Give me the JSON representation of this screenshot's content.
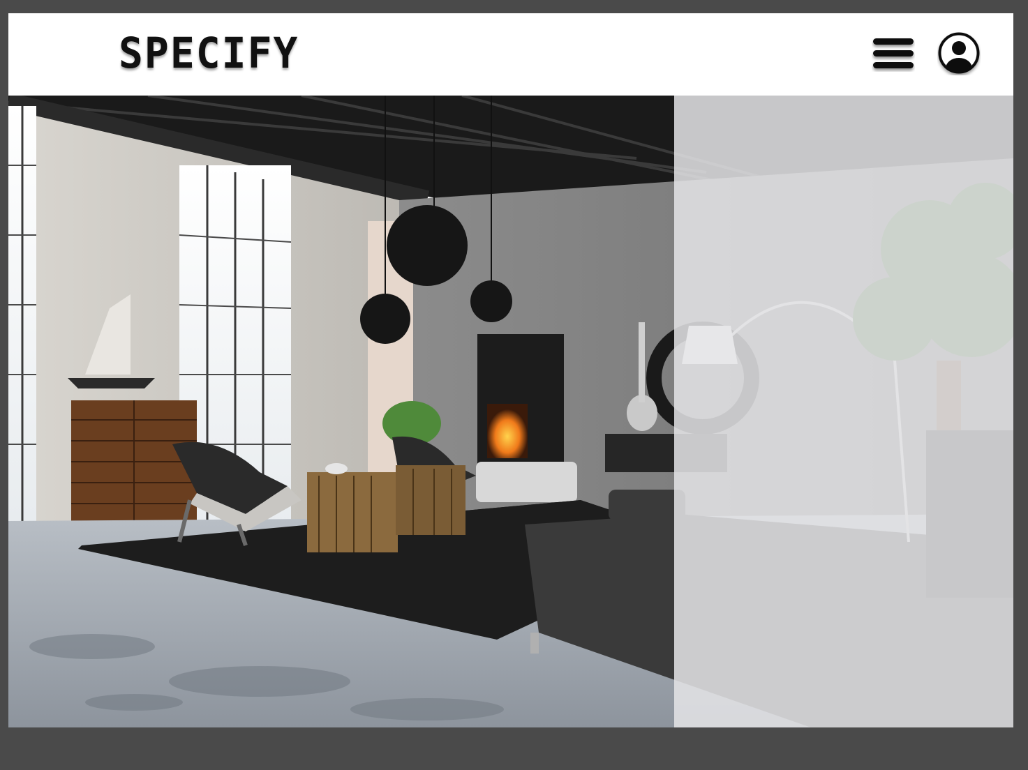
{
  "header": {
    "logo_text": "SPECIFY",
    "menu_icon": "hamburger-menu-icon",
    "user_icon": "user-account-icon"
  },
  "hero": {
    "image": "industrial-loft-living-room-photo",
    "overlay": "translucent-side-panel"
  },
  "colors": {
    "background": "#4a4a4a",
    "header_bg": "#ffffff",
    "logo": "#111111",
    "overlay": "#e4e4e6"
  }
}
